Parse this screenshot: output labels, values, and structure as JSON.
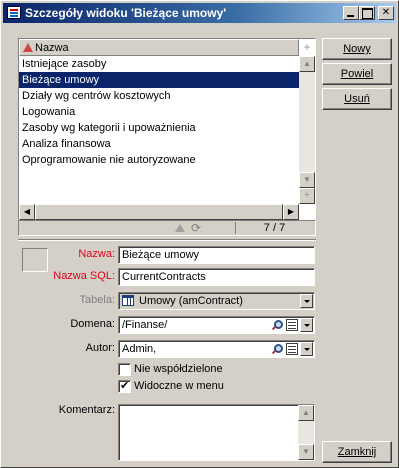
{
  "window": {
    "title": "Szczegóły widoku 'Bieżące umowy'"
  },
  "list": {
    "column_header": "Nazwa",
    "rows": [
      {
        "label": "Istniejące zasoby",
        "selected": false
      },
      {
        "label": "Bieżące umowy",
        "selected": true
      },
      {
        "label": "Działy wg centrów kosztowych",
        "selected": false
      },
      {
        "label": "Logowania",
        "selected": false
      },
      {
        "label": "Zasoby wg kategorii i upoważnienia",
        "selected": false
      },
      {
        "label": "Analiza finansowa",
        "selected": false
      },
      {
        "label": "Oprogramowanie nie autoryzowane",
        "selected": false
      }
    ],
    "count": "7 / 7"
  },
  "buttons": {
    "new": "Nowy",
    "duplicate": "Powiel",
    "delete": "Usuń",
    "close": "Zamknij"
  },
  "form": {
    "name_label": "Nazwa:",
    "name_value": "Bieżące umowy",
    "sql_name_label": "Nazwa SQL:",
    "sql_name_value": "CurrentContracts",
    "table_label": "Tabela:",
    "table_value": "Umowy (amContract)",
    "domain_label": "Domena:",
    "domain_value": "/Finanse/",
    "author_label": "Autor:",
    "author_value": "Admin,",
    "not_shared_label": "Nie współdzielone",
    "not_shared_checked": false,
    "visible_in_menu_label": "Widoczne w menu",
    "visible_in_menu_checked": true,
    "comment_label": "Komentarz:",
    "comment_value": ""
  },
  "colors": {
    "required_label": "#e0001b",
    "selection": "#0a246a",
    "window_bg": "#d4d0c8"
  }
}
